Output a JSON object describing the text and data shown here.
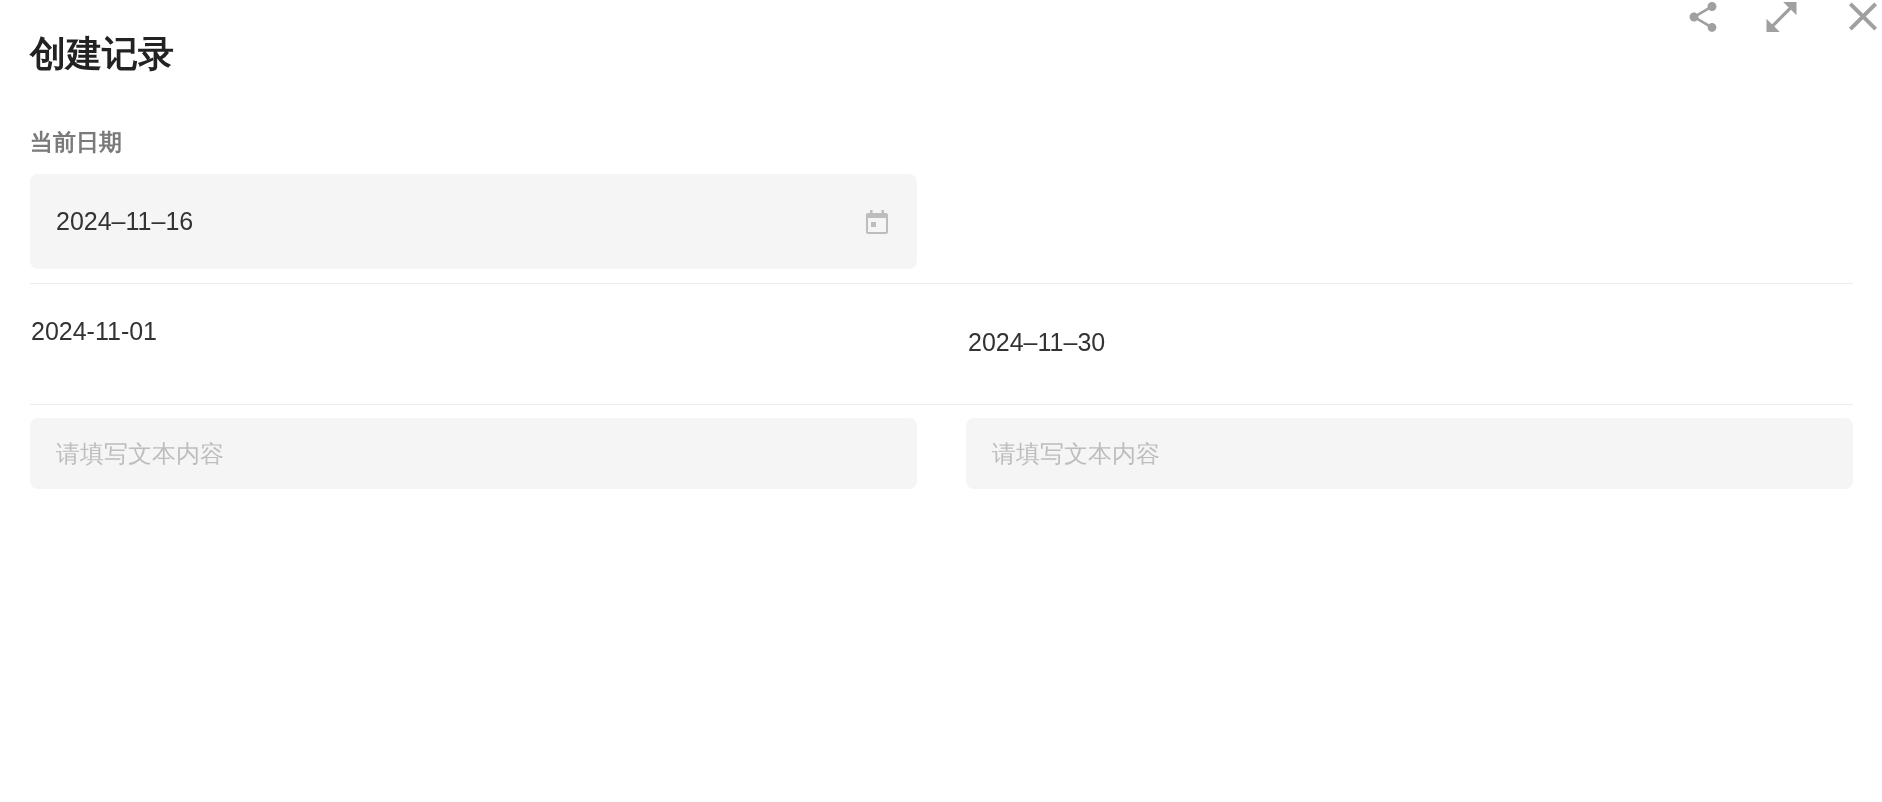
{
  "dialog": {
    "title": "创建记录"
  },
  "current_date": {
    "label": "当前日期",
    "value": "2024–11–16"
  },
  "range": {
    "start": "2024-11-01",
    "end": "2024–11–30"
  },
  "text_fields": [
    {
      "placeholder": "请填写文本内容"
    },
    {
      "placeholder": "请填写文本内容"
    }
  ]
}
